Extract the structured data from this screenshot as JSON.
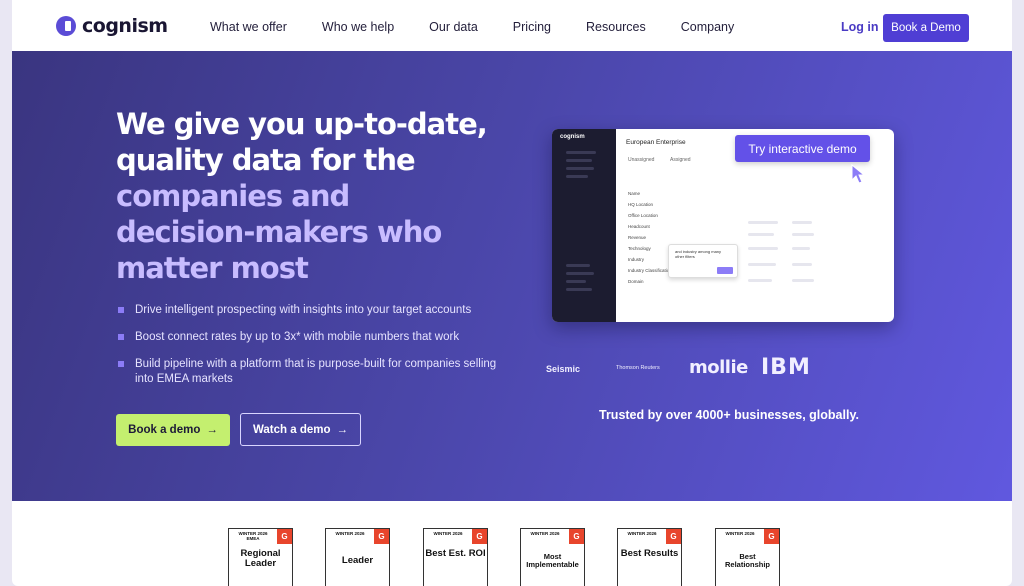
{
  "brand": {
    "name": "cognism"
  },
  "nav": {
    "links": [
      "What we offer",
      "Who we help",
      "Our data",
      "Pricing",
      "Resources",
      "Company"
    ],
    "login": "Log in",
    "book_demo": "Book a Demo"
  },
  "hero": {
    "headline_white": [
      "We give you up-to-date,",
      "quality data for the"
    ],
    "headline_purple": [
      "companies and",
      "decision-makers who",
      "matter most"
    ],
    "bullets": [
      "Drive intelligent prospecting with insights into your target accounts",
      "Boost connect rates by up to 3x* with mobile numbers that work",
      "Build pipeline with a platform that is purpose-built for companies selling into EMEA markets"
    ],
    "cta_primary": "Book a demo",
    "cta_secondary": "Watch a demo",
    "arrow": "→"
  },
  "product_preview": {
    "brand": "cognism",
    "title": "European Enterprise",
    "tabs": [
      "Unassigned",
      "Assigned"
    ],
    "filter_rows": [
      "Name",
      "HQ Location",
      "Office Location",
      "Headcount",
      "Revenue",
      "Technology",
      "Industry",
      "Industry Classification",
      "Domain"
    ],
    "popup_text": "and industry among many other filters",
    "try_demo": "Try interactive demo"
  },
  "logos": {
    "seismic": "Seismic",
    "thomson": "Thomson Reuters",
    "mollie": "mollie",
    "ibm": "IBM"
  },
  "trusted_text": "Trusted by over 4000+ businesses, globally.",
  "badges": [
    {
      "season": "WINTER 2026",
      "sub": "EMEA",
      "label": "Regional Leader",
      "g": "G"
    },
    {
      "season": "WINTER 2026",
      "sub": "",
      "label": "Leader",
      "g": "G"
    },
    {
      "season": "WINTER 2026",
      "sub": "",
      "label": "Best Est. ROI",
      "g": "G"
    },
    {
      "season": "WINTER 2026",
      "sub": "",
      "label": "Most Implementable",
      "g": "G"
    },
    {
      "season": "WINTER 2026",
      "sub": "",
      "label": "Best Results",
      "g": "G"
    },
    {
      "season": "WINTER 2026",
      "sub": "",
      "label": "Best Relationship",
      "g": "G"
    }
  ]
}
